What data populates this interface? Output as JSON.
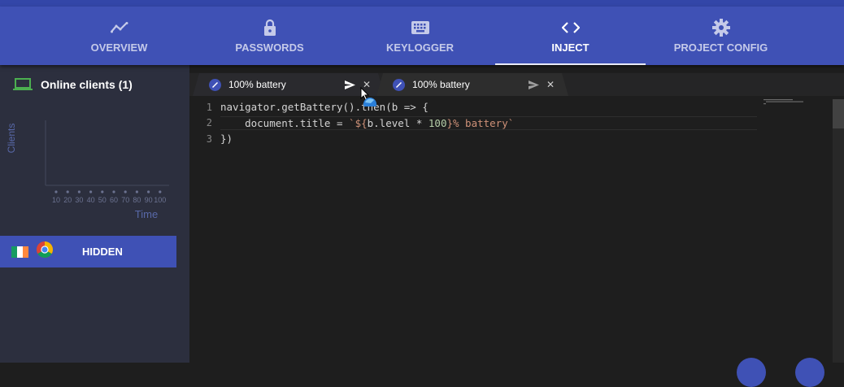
{
  "nav": {
    "tabs": [
      {
        "label": "OVERVIEW",
        "icon": "trending-line-icon"
      },
      {
        "label": "PASSWORDS",
        "icon": "lock-icon"
      },
      {
        "label": "KEYLOGGER",
        "icon": "keyboard-icon"
      },
      {
        "label": "INJECT",
        "icon": "code-icon",
        "active": true
      },
      {
        "label": "PROJECT CONFIG",
        "icon": "gear-icon"
      }
    ]
  },
  "sidebar": {
    "online_label": "Online clients (1)",
    "chart": {
      "ylabel": "Clients",
      "xlabel": "Time",
      "ticks": [
        "10",
        "20",
        "30",
        "40",
        "50",
        "60",
        "70",
        "80",
        "90",
        "100"
      ]
    },
    "client": {
      "label": "HIDDEN",
      "flag_colors": [
        "#169b62",
        "#ffffff",
        "#ff883e"
      ]
    }
  },
  "editor": {
    "tabs": [
      {
        "label": "100% battery",
        "active": true
      },
      {
        "label": "100% battery",
        "active": false
      }
    ],
    "line_numbers": [
      "1",
      "2",
      "3"
    ],
    "code": {
      "l1": "navigator.getBattery().then(b => {",
      "l2_a": "    document.title = ",
      "l2_b": "`${",
      "l2_c": "b.level * ",
      "l2_d": "100",
      "l2_e": "}% battery`",
      "l3": "})"
    }
  },
  "colors": {
    "primary": "#3f51b5",
    "sidebar": "#2c2f3e",
    "editor_bg": "#1e1e1e",
    "online_icon": "#4caf50"
  }
}
